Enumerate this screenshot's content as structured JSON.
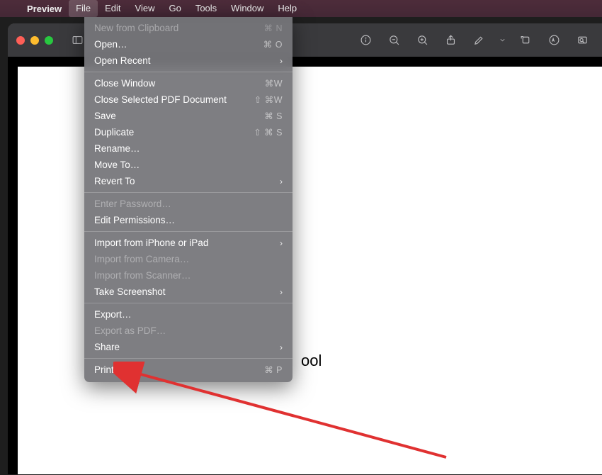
{
  "menubar": {
    "app_name": "Preview",
    "items": [
      "File",
      "Edit",
      "View",
      "Go",
      "Tools",
      "Window",
      "Help"
    ],
    "active_index": 0
  },
  "dropdown": {
    "groups": [
      [
        {
          "label": "New from Clipboard",
          "shortcut": "⌘ N",
          "disabled": true
        },
        {
          "label": "Open…",
          "shortcut": "⌘ O"
        },
        {
          "label": "Open Recent",
          "submenu": true
        }
      ],
      [
        {
          "label": "Close Window",
          "shortcut": "⌘W"
        },
        {
          "label": "Close Selected PDF Document",
          "shortcut": "⇧ ⌘W"
        },
        {
          "label": "Save",
          "shortcut": "⌘ S"
        },
        {
          "label": "Duplicate",
          "shortcut": "⇧ ⌘ S"
        },
        {
          "label": "Rename…"
        },
        {
          "label": "Move To…"
        },
        {
          "label": "Revert To",
          "submenu": true
        }
      ],
      [
        {
          "label": "Enter Password…",
          "disabled": true
        },
        {
          "label": "Edit Permissions…"
        }
      ],
      [
        {
          "label": "Import from iPhone or iPad",
          "submenu": true
        },
        {
          "label": "Import from Camera…",
          "disabled": true
        },
        {
          "label": "Import from Scanner…",
          "disabled": true
        },
        {
          "label": "Take Screenshot",
          "submenu": true
        }
      ],
      [
        {
          "label": "Export…"
        },
        {
          "label": "Export as PDF…",
          "disabled": true
        },
        {
          "label": "Share",
          "submenu": true
        }
      ],
      [
        {
          "label": "Print…",
          "shortcut": "⌘ P"
        }
      ]
    ]
  },
  "toolbar_icons": [
    "sidebar-icon",
    "info-icon",
    "zoom-out-icon",
    "zoom-in-icon",
    "share-icon",
    "highlight-icon",
    "chevron-down-icon",
    "rotate-icon",
    "markup-icon",
    "search-icon"
  ],
  "document": {
    "visible_text_fragment": "ool"
  },
  "annotation": {
    "type": "arrow",
    "color": "#e03131",
    "points_to": "Print…"
  }
}
